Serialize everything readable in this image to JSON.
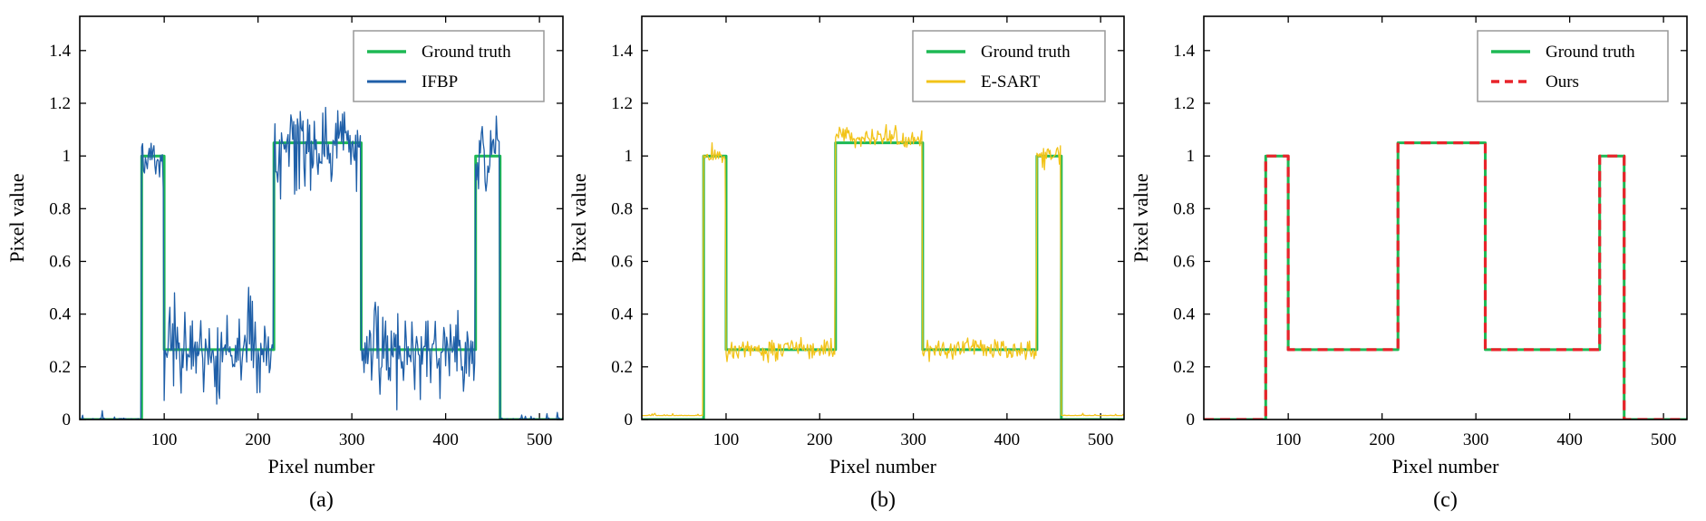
{
  "colors": {
    "ground_truth": "#1db954",
    "ifbp": "#1f5fa8",
    "esart": "#f2c318",
    "ours": "#e8232a"
  },
  "chart_data": [
    {
      "type": "line",
      "caption": "(a)",
      "xlabel": "Pixel number",
      "ylabel": "Pixel value",
      "xlim": [
        10,
        525
      ],
      "ylim": [
        0,
        1.53
      ],
      "xticks": [
        100,
        200,
        300,
        400,
        500
      ],
      "yticks": [
        0,
        0.2,
        0.4,
        0.6,
        0.8,
        1,
        1.2,
        1.4
      ],
      "ytick_labels": [
        "0",
        "0.2",
        "0.4",
        "0.6",
        "0.8",
        "1",
        "1.2",
        "1.4"
      ],
      "legend_position": "top-right",
      "series": [
        {
          "name": "Ground truth",
          "style": "solid",
          "color": "#1db954",
          "x": [
            10,
            76,
            76,
            100,
            100,
            217,
            217,
            310,
            310,
            432,
            432,
            458,
            458,
            525
          ],
          "y": [
            0,
            0,
            1.0,
            1.0,
            0.265,
            0.265,
            1.05,
            1.05,
            0.265,
            0.265,
            1.0,
            1.0,
            0,
            0
          ]
        },
        {
          "name": "IFBP",
          "style": "noisy",
          "color": "#1f5fa8",
          "noise": 0.085,
          "seed": 7,
          "x": [
            10,
            76,
            76,
            100,
            100,
            217,
            217,
            310,
            310,
            432,
            432,
            458,
            458,
            525
          ],
          "y": [
            0,
            0,
            1.0,
            1.0,
            0.265,
            0.265,
            1.05,
            1.05,
            0.265,
            0.265,
            1.0,
            1.0,
            0,
            0
          ]
        }
      ]
    },
    {
      "type": "line",
      "caption": "(b)",
      "xlabel": "Pixel number",
      "ylabel": "Pixel value",
      "xlim": [
        10,
        525
      ],
      "ylim": [
        0,
        1.53
      ],
      "xticks": [
        100,
        200,
        300,
        400,
        500
      ],
      "yticks": [
        0,
        0.2,
        0.4,
        0.6,
        0.8,
        1,
        1.2,
        1.4
      ],
      "ytick_labels": [
        "0",
        "0.2",
        "0.4",
        "0.6",
        "0.8",
        "1",
        "1.2",
        "1.4"
      ],
      "legend_position": "top-right",
      "series": [
        {
          "name": "Ground truth",
          "style": "solid",
          "color": "#1db954",
          "x": [
            10,
            76,
            76,
            100,
            100,
            217,
            217,
            310,
            310,
            432,
            432,
            458,
            458,
            525
          ],
          "y": [
            0,
            0,
            1.0,
            1.0,
            0.265,
            0.265,
            1.05,
            1.05,
            0.265,
            0.265,
            1.0,
            1.0,
            0,
            0
          ]
        },
        {
          "name": "E-SART",
          "style": "noisy",
          "color": "#f2c318",
          "noise": 0.02,
          "seed": 13,
          "x": [
            10,
            76,
            76,
            100,
            100,
            217,
            217,
            310,
            310,
            432,
            432,
            458,
            458,
            525
          ],
          "y": [
            0.015,
            0.015,
            1.0,
            1.0,
            0.265,
            0.265,
            1.07,
            1.07,
            0.265,
            0.265,
            1.0,
            1.0,
            0.015,
            0.015
          ]
        }
      ]
    },
    {
      "type": "line",
      "caption": "(c)",
      "xlabel": "Pixel number",
      "ylabel": "Pixel value",
      "xlim": [
        10,
        525
      ],
      "ylim": [
        0,
        1.53
      ],
      "xticks": [
        100,
        200,
        300,
        400,
        500
      ],
      "yticks": [
        0,
        0.2,
        0.4,
        0.6,
        0.8,
        1,
        1.2,
        1.4
      ],
      "ytick_labels": [
        "0",
        "0.2",
        "0.4",
        "0.6",
        "0.8",
        "1",
        "1.2",
        "1.4"
      ],
      "legend_position": "top-right",
      "series": [
        {
          "name": "Ground truth",
          "style": "solid",
          "color": "#1db954",
          "x": [
            10,
            76,
            76,
            100,
            100,
            217,
            217,
            310,
            310,
            432,
            432,
            458,
            458,
            525
          ],
          "y": [
            0,
            0,
            1.0,
            1.0,
            0.265,
            0.265,
            1.05,
            1.05,
            0.265,
            0.265,
            1.0,
            1.0,
            0,
            0
          ]
        },
        {
          "name": "Ours",
          "style": "dashed",
          "color": "#e8232a",
          "x": [
            10,
            76,
            76,
            100,
            100,
            217,
            217,
            310,
            310,
            432,
            432,
            458,
            458,
            525
          ],
          "y": [
            0,
            0,
            1.0,
            1.0,
            0.265,
            0.265,
            1.05,
            1.05,
            0.265,
            0.265,
            1.0,
            1.0,
            0,
            0
          ]
        }
      ]
    }
  ]
}
